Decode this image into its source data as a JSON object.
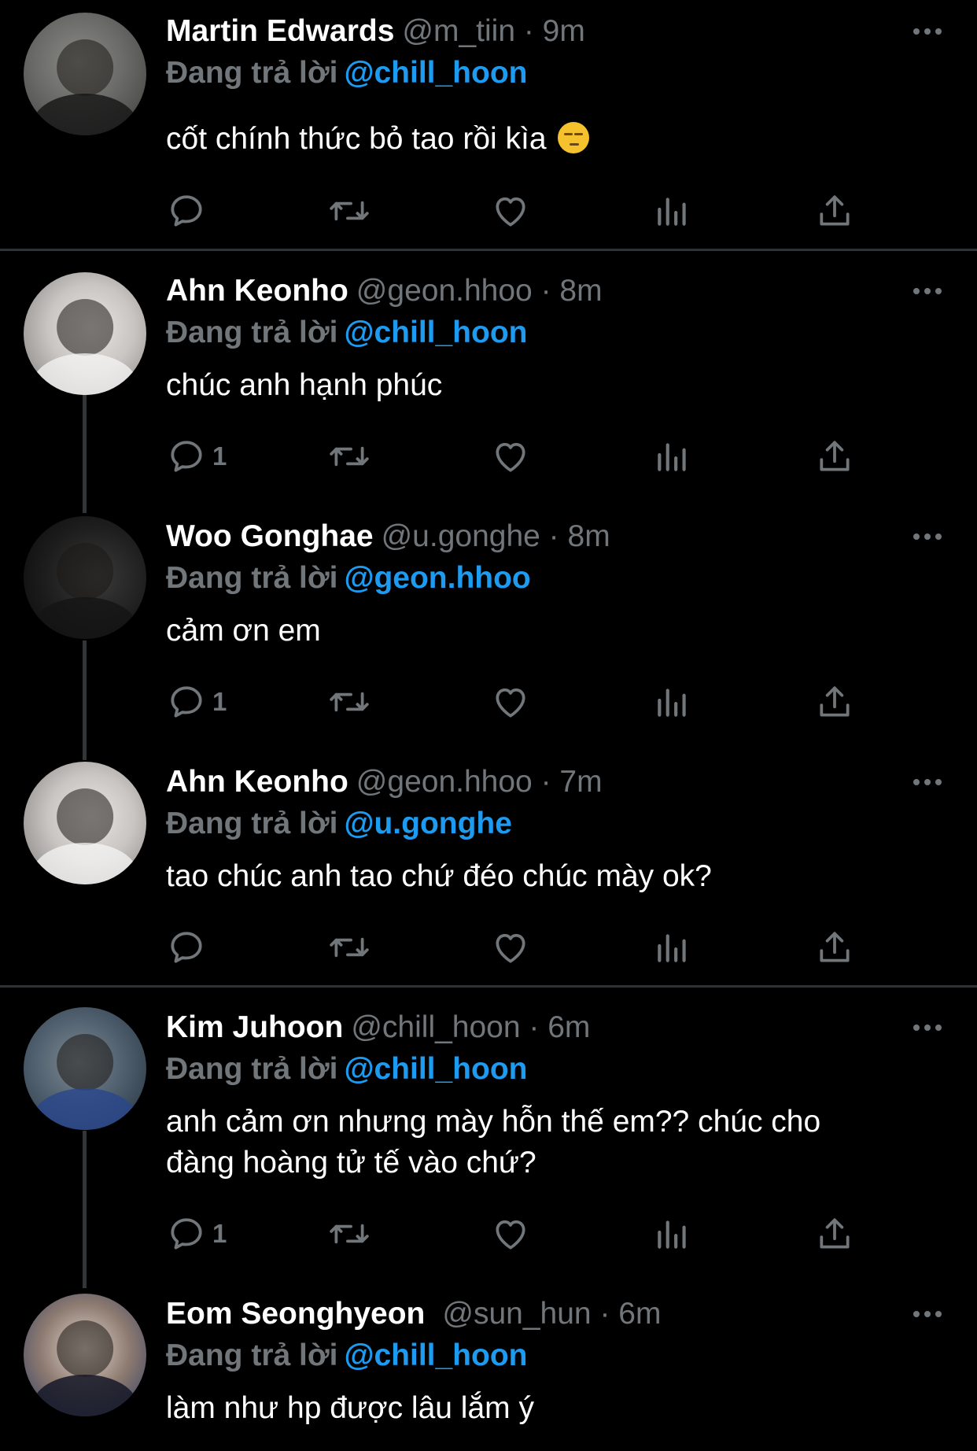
{
  "reply_prefix": "Đang trả lời",
  "tweets": [
    {
      "name": "Martin Edwards",
      "meta": "@m_tiin · 9m",
      "replying_to": "@chill_hoon",
      "text": "cốt chính thức bỏ tao rồi kìa",
      "emoji": "unamused-face-emoji",
      "reply_count": ""
    },
    {
      "name": "Ahn Keonho",
      "meta": "@geon.hhoo · 8m",
      "replying_to": "@chill_hoon",
      "text": "chúc anh hạnh phúc",
      "reply_count": "1"
    },
    {
      "name": "Woo Gonghae",
      "meta": "@u.gonghe · 8m",
      "replying_to": "@geon.hhoo",
      "text": "cảm ơn em",
      "reply_count": "1"
    },
    {
      "name": "Ahn Keonho",
      "meta": "@geon.hhoo · 7m",
      "replying_to": "@u.gonghe",
      "text": "tao chúc anh tao chứ đéo chúc mày ok?",
      "reply_count": ""
    },
    {
      "name": "Kim Juhoon",
      "meta": "@chill_hoon · 6m",
      "replying_to": "@chill_hoon",
      "text_lines": [
        "anh cảm ơn nhưng mày hỗn thế em?? chúc cho",
        "đàng hoàng tử tế vào chứ?"
      ],
      "reply_count": "1"
    },
    {
      "name": "Eom Seonghyeon",
      "meta": "@sun_hun · 6m",
      "replying_to": "@chill_hoon",
      "text": "làm như hp được lâu lắm ý",
      "reply_count": ""
    }
  ],
  "icons": {
    "reply": "reply-bubble-icon",
    "retweet": "retweet-arrows-icon",
    "like": "heart-icon",
    "views": "bar-chart-icon",
    "share": "share-upload-icon",
    "more": "more-dots-icon"
  },
  "colors": {
    "background": "#000000",
    "text": "#ffffff",
    "secondary": "#71767b",
    "link": "#1d9bf0",
    "divider": "#2f3336"
  }
}
